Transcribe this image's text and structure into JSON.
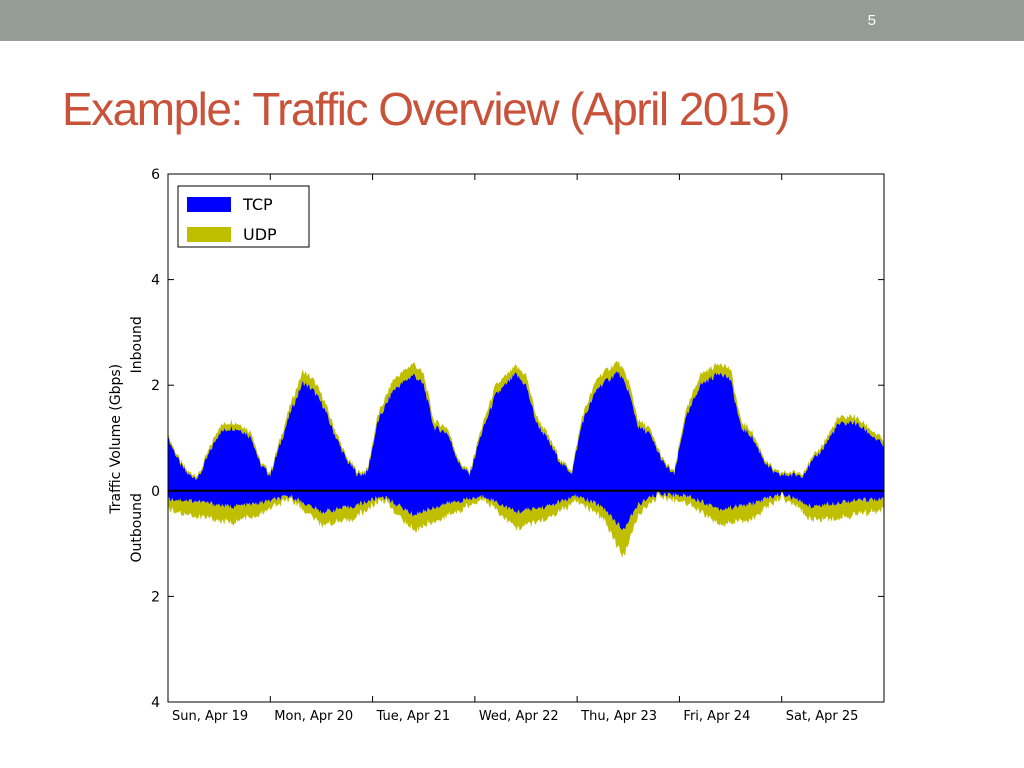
{
  "slide": {
    "number": "5",
    "title": "Example: Traffic Overview (April 2015)"
  },
  "chart_data": {
    "type": "area",
    "title": "",
    "ylabel": "Traffic Volume (Gbps)",
    "ylabel_upper": "Inbound",
    "ylabel_lower": "Outbound",
    "ylim": [
      -4,
      6
    ],
    "yticks": [
      {
        "value": 6,
        "label": "6"
      },
      {
        "value": 4,
        "label": "4"
      },
      {
        "value": 2,
        "label": "2"
      },
      {
        "value": 0,
        "label": "0"
      },
      {
        "value": -2,
        "label": "2"
      },
      {
        "value": -4,
        "label": "4"
      }
    ],
    "xlim": [
      0,
      7
    ],
    "xticks": [
      {
        "value": 0,
        "label": "Sun, Apr 19"
      },
      {
        "value": 1,
        "label": "Mon, Apr 20"
      },
      {
        "value": 2,
        "label": "Tue, Apr 21"
      },
      {
        "value": 3,
        "label": "Wed, Apr 22"
      },
      {
        "value": 4,
        "label": "Thu, Apr 23"
      },
      {
        "value": 5,
        "label": "Fri, Apr 24"
      },
      {
        "value": 6,
        "label": "Sat, Apr 25"
      }
    ],
    "legend_position": "top-left",
    "grid": false,
    "series": [
      {
        "name": "TCP",
        "color": "#0000ff",
        "inbound_x": [
          0,
          0.12,
          0.2,
          0.3,
          0.4,
          0.5,
          0.62,
          0.72,
          0.82,
          0.9,
          1.0,
          1.2,
          1.32,
          1.42,
          1.52,
          1.6,
          1.74,
          1.86,
          1.95,
          2.05,
          2.2,
          2.4,
          2.5,
          2.6,
          2.73,
          2.85,
          2.95,
          3.05,
          3.2,
          3.4,
          3.5,
          3.6,
          3.7,
          3.85,
          3.95,
          4.05,
          4.2,
          4.4,
          4.5,
          4.6,
          4.7,
          4.85,
          4.95,
          5.05,
          5.2,
          5.4,
          5.5,
          5.6,
          5.7,
          5.85,
          5.95,
          6.05,
          6.2,
          6.4,
          6.55,
          6.7,
          6.82,
          7.0
        ],
        "inbound_y": [
          1.0,
          0.5,
          0.3,
          0.25,
          0.7,
          1.1,
          1.2,
          1.15,
          1.0,
          0.5,
          0.3,
          1.5,
          2.05,
          1.9,
          1.6,
          1.2,
          0.6,
          0.3,
          0.35,
          1.3,
          1.9,
          2.2,
          2.0,
          1.2,
          1.1,
          0.5,
          0.3,
          1.0,
          1.8,
          2.2,
          2.0,
          1.3,
          1.0,
          0.5,
          0.35,
          1.3,
          1.95,
          2.25,
          1.9,
          1.2,
          1.1,
          0.5,
          0.3,
          1.3,
          2.0,
          2.25,
          2.1,
          1.2,
          1.05,
          0.5,
          0.3,
          0.3,
          0.3,
          0.8,
          1.25,
          1.3,
          1.15,
          0.85
        ],
        "outbound_x": [
          0,
          0.3,
          0.6,
          0.85,
          1.2,
          1.5,
          1.8,
          2.1,
          2.4,
          2.7,
          3.1,
          3.4,
          3.7,
          4.0,
          4.25,
          4.45,
          4.6,
          4.8,
          5.1,
          5.4,
          5.7,
          6.0,
          6.3,
          6.6,
          7.0
        ],
        "outbound_y": [
          -0.15,
          -0.2,
          -0.3,
          -0.25,
          -0.1,
          -0.4,
          -0.3,
          -0.1,
          -0.45,
          -0.25,
          -0.1,
          -0.4,
          -0.3,
          -0.1,
          -0.3,
          -0.75,
          -0.25,
          -0.05,
          -0.1,
          -0.35,
          -0.25,
          -0.05,
          -0.3,
          -0.2,
          -0.15
        ]
      },
      {
        "name": "UDP",
        "color": "#bfbf00",
        "inbound_x": [
          0,
          0.12,
          0.2,
          0.3,
          0.4,
          0.5,
          0.62,
          0.72,
          0.82,
          0.9,
          1.0,
          1.2,
          1.32,
          1.42,
          1.52,
          1.6,
          1.74,
          1.86,
          1.95,
          2.05,
          2.2,
          2.4,
          2.5,
          2.6,
          2.73,
          2.85,
          2.95,
          3.05,
          3.2,
          3.4,
          3.5,
          3.6,
          3.7,
          3.85,
          3.95,
          4.05,
          4.2,
          4.4,
          4.5,
          4.6,
          4.7,
          4.85,
          4.95,
          5.05,
          5.2,
          5.4,
          5.5,
          5.6,
          5.7,
          5.85,
          5.95,
          6.05,
          6.2,
          6.4,
          6.55,
          6.7,
          6.82,
          7.0
        ],
        "inbound_y": [
          0.05,
          0.05,
          0.05,
          0.05,
          0.08,
          0.12,
          0.12,
          0.1,
          0.1,
          0.05,
          0.05,
          0.15,
          0.22,
          0.2,
          0.15,
          0.12,
          0.05,
          0.05,
          0.05,
          0.12,
          0.2,
          0.22,
          0.2,
          0.12,
          0.1,
          0.05,
          0.05,
          0.1,
          0.18,
          0.15,
          0.2,
          0.12,
          0.1,
          0.05,
          0.05,
          0.12,
          0.2,
          0.2,
          0.2,
          0.12,
          0.1,
          0.05,
          0.05,
          0.12,
          0.2,
          0.18,
          0.2,
          0.12,
          0.1,
          0.05,
          0.05,
          0.05,
          0.05,
          0.08,
          0.12,
          0.12,
          0.1,
          0.1
        ],
        "outbound_x": [
          0,
          0.3,
          0.6,
          0.85,
          1.2,
          1.5,
          1.8,
          2.1,
          2.4,
          2.7,
          3.1,
          3.4,
          3.7,
          4.0,
          4.25,
          4.45,
          4.6,
          4.8,
          5.1,
          5.4,
          5.7,
          6.0,
          6.3,
          6.6,
          7.0
        ],
        "outbound_y": [
          -0.2,
          -0.3,
          -0.3,
          -0.25,
          -0.05,
          -0.25,
          -0.25,
          -0.05,
          -0.3,
          -0.25,
          -0.05,
          -0.3,
          -0.25,
          -0.1,
          -0.2,
          -0.5,
          -0.2,
          -0.05,
          -0.15,
          -0.3,
          -0.3,
          -0.05,
          -0.25,
          -0.3,
          -0.2
        ]
      }
    ]
  }
}
